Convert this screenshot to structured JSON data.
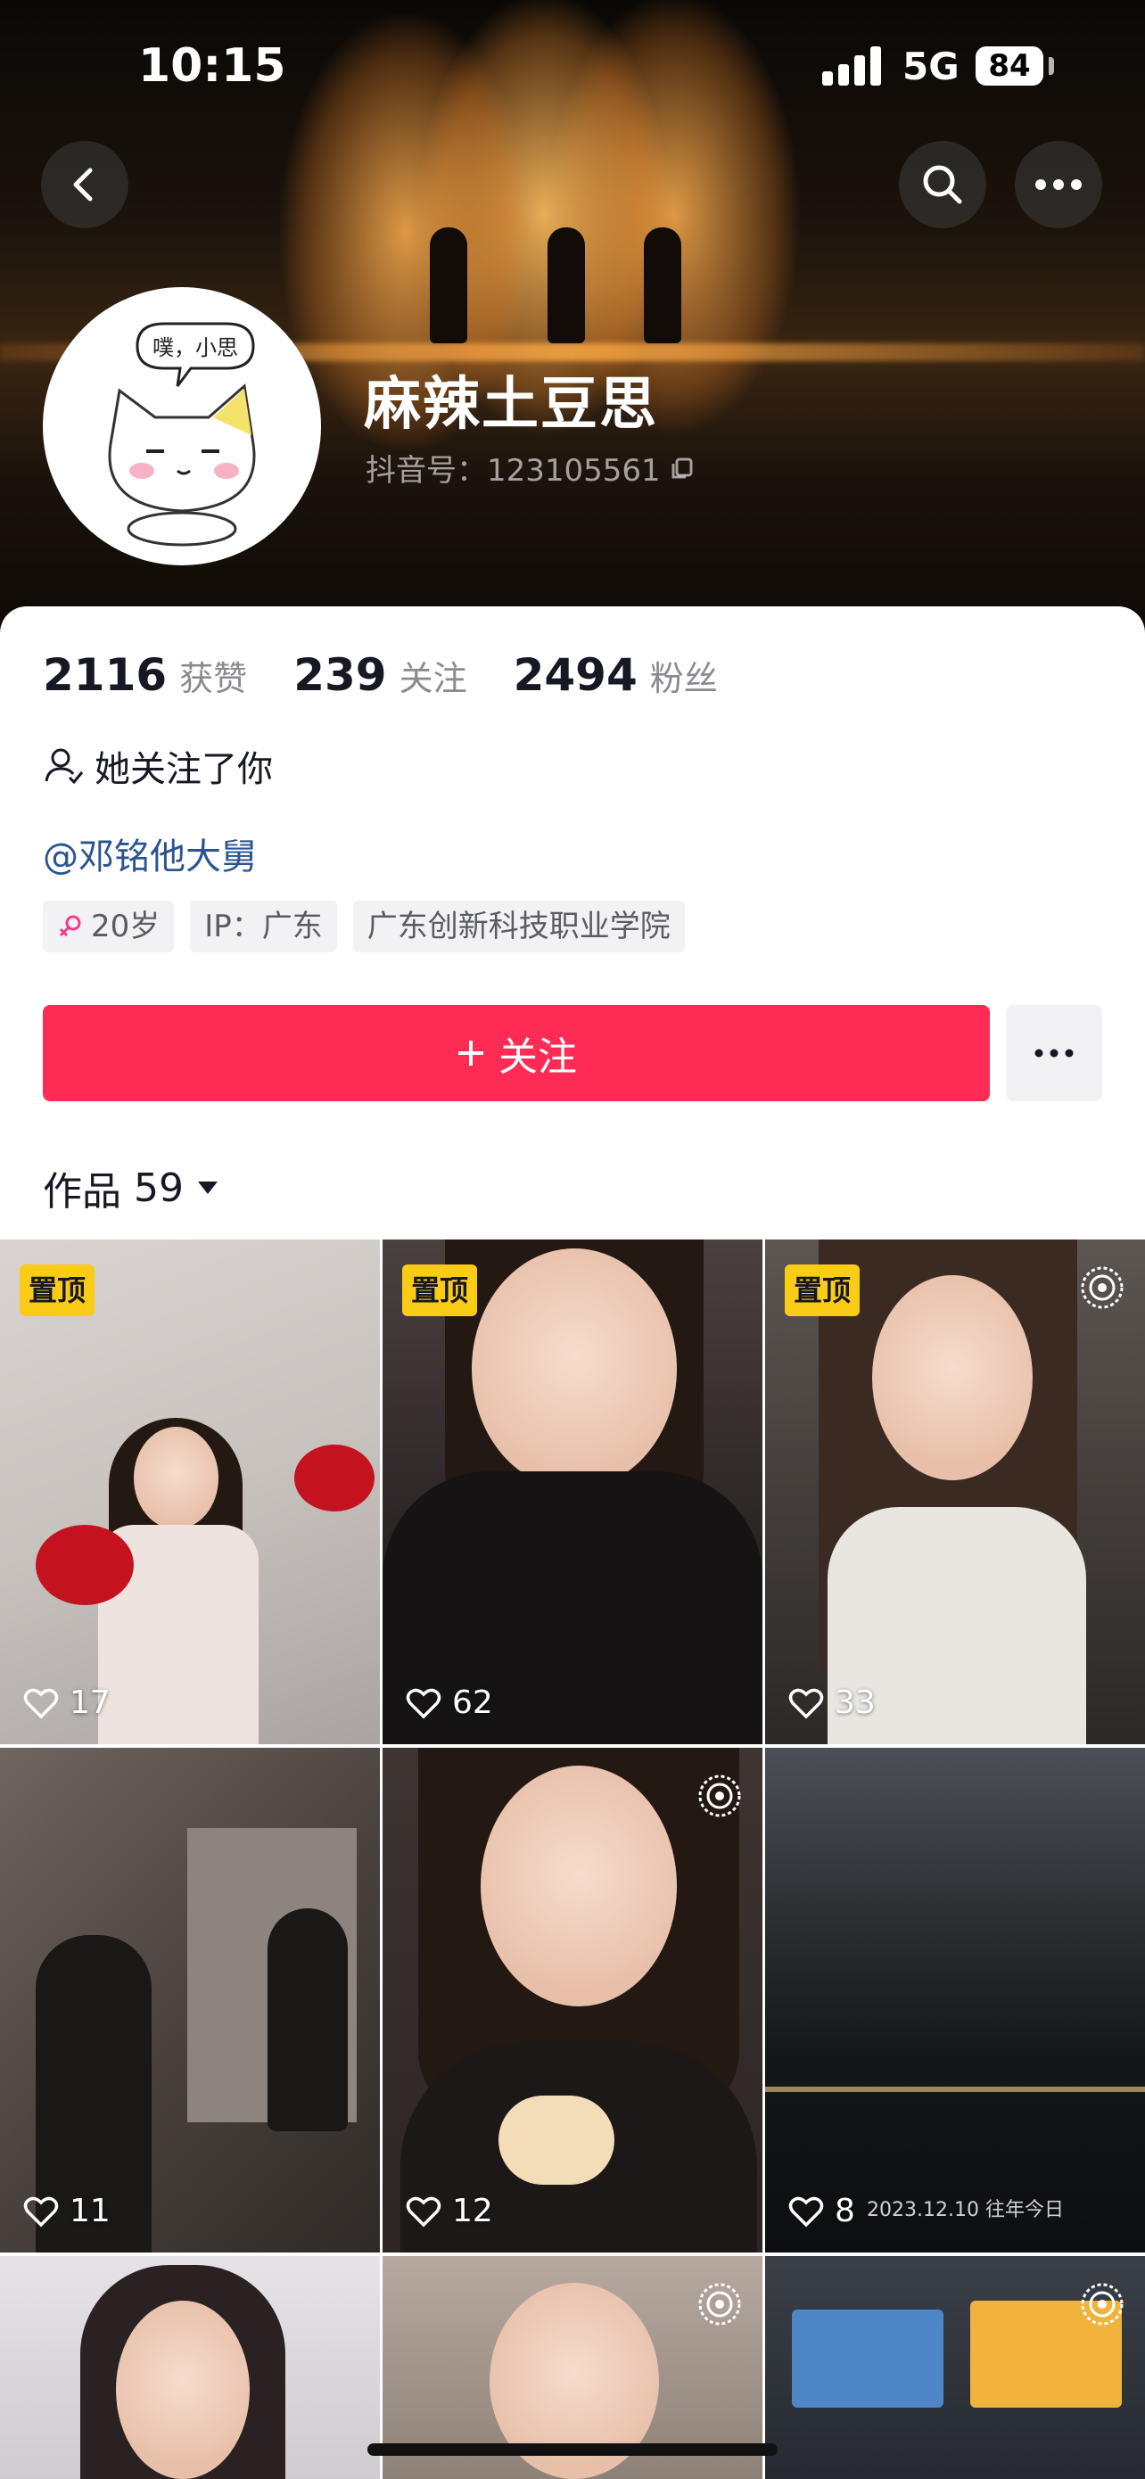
{
  "status_bar": {
    "time": "10:15",
    "network": "5G",
    "battery": "84"
  },
  "profile": {
    "nickname": "麻辣土豆思",
    "douyin_id": "抖音号：123105561",
    "avatar_bubble_text": "噗，小思",
    "stats": [
      {
        "value": "2116",
        "label": "获赞"
      },
      {
        "value": "239",
        "label": "关注"
      },
      {
        "value": "2494",
        "label": "粉丝"
      }
    ],
    "follows_you": "她关注了你",
    "mention": "@邓铭他大舅",
    "tags": {
      "age": "20岁",
      "ip": "IP：广东",
      "school": "广东创新科技职业学院"
    }
  },
  "actions": {
    "follow_label": "关注"
  },
  "works": {
    "label": "作品",
    "count": "59"
  },
  "grid": [
    {
      "likes": "17",
      "pinned": "置顶"
    },
    {
      "likes": "62",
      "pinned": "置顶"
    },
    {
      "likes": "33",
      "pinned": "置顶"
    },
    {
      "likes": "11"
    },
    {
      "likes": "12"
    },
    {
      "likes": "8",
      "caption": "2023.12.10 往年今日"
    },
    {},
    {},
    {}
  ],
  "colors": {
    "accent": "#fe2c55",
    "pin": "#facc15",
    "link": "#2a5490"
  },
  "icons": [
    "back-icon",
    "search-icon",
    "more-icon",
    "copy-icon",
    "user-follow-icon",
    "female-icon",
    "plus-icon",
    "dropdown-icon",
    "heart-icon",
    "live-icon"
  ]
}
